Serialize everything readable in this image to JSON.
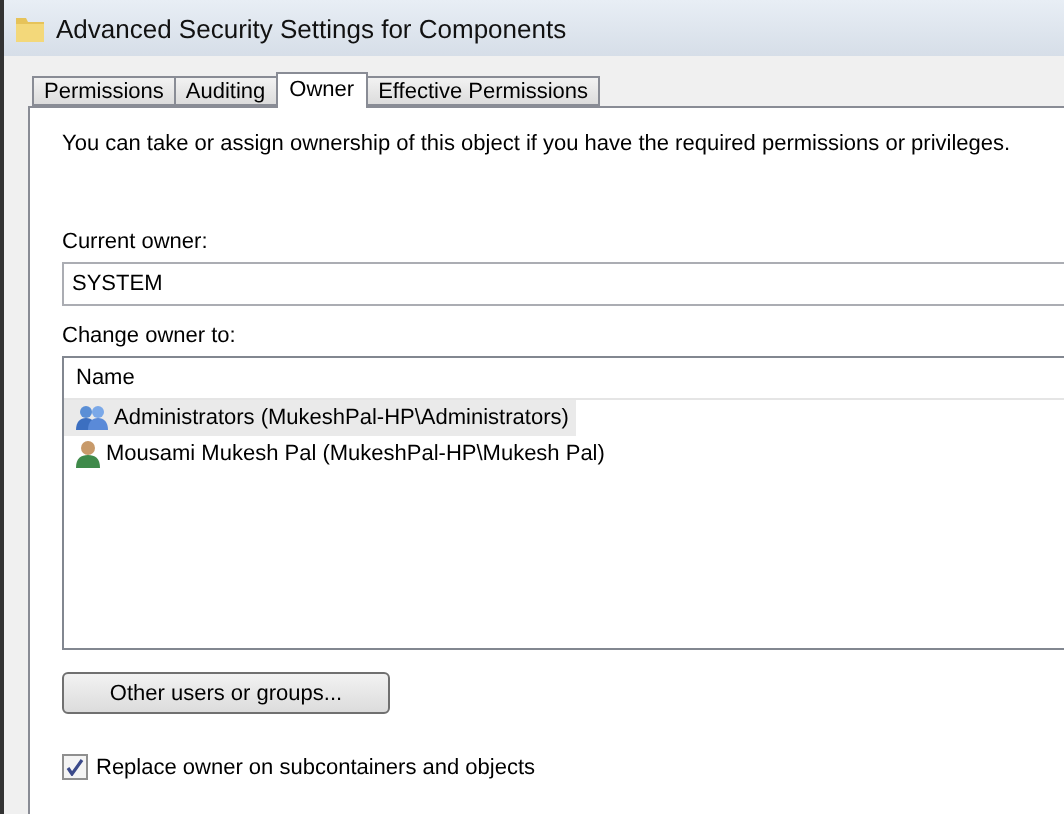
{
  "window": {
    "title": "Advanced Security Settings for Components"
  },
  "tabs": [
    {
      "label": "Permissions",
      "selected": false
    },
    {
      "label": "Auditing",
      "selected": false
    },
    {
      "label": "Owner",
      "selected": true
    },
    {
      "label": "Effective Permissions",
      "selected": false
    }
  ],
  "intro": "You can take or assign ownership of this object if you have the required permissions or privileges.",
  "current_owner": {
    "label": "Current owner:",
    "value": "SYSTEM"
  },
  "change_owner": {
    "label": "Change owner to:",
    "column": "Name",
    "rows": [
      {
        "kind": "group",
        "name": "Administrators (MukeshPal-HP\\Administrators)",
        "selected": true
      },
      {
        "kind": "user",
        "name": "Mousami Mukesh Pal (MukeshPal-HP\\Mukesh Pal)",
        "selected": false
      }
    ]
  },
  "other_button": "Other users or groups...",
  "replace": {
    "label": "Replace owner on subcontainers and objects",
    "checked": true
  }
}
